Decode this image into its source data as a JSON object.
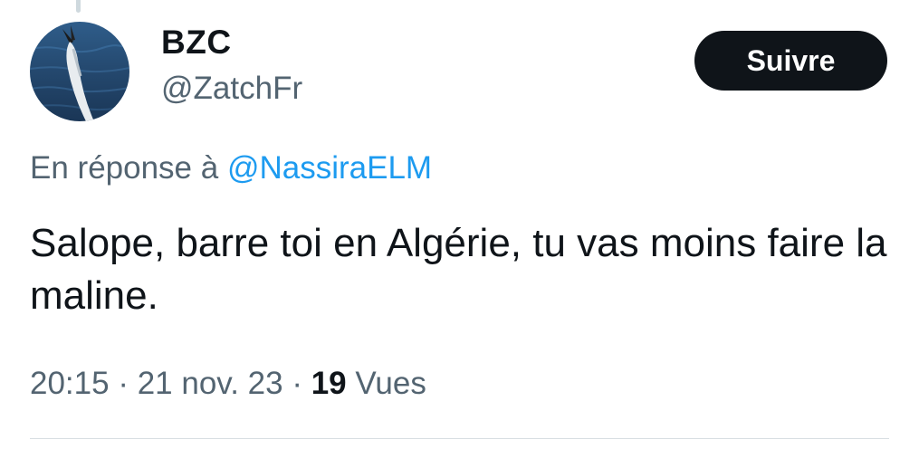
{
  "tweet": {
    "author": {
      "display_name": "BZC",
      "handle": "@ZatchFr",
      "avatar_icon": "avatar-image"
    },
    "follow_button_label": "Suivre",
    "reply_prefix": "En réponse à",
    "reply_to_handle": "@NassiraELM",
    "text": "Salope, barre toi en Algérie, tu vas moins faire la maline.",
    "time": "20:15",
    "separator": "·",
    "date": "21 nov. 23",
    "views_count": "19",
    "views_label": "Vues"
  },
  "colors": {
    "text_primary": "#0f1419",
    "text_secondary": "#536471",
    "link": "#1d9bf0",
    "button_bg": "#0f1419",
    "button_text": "#ffffff",
    "divider": "#d8dee2"
  }
}
